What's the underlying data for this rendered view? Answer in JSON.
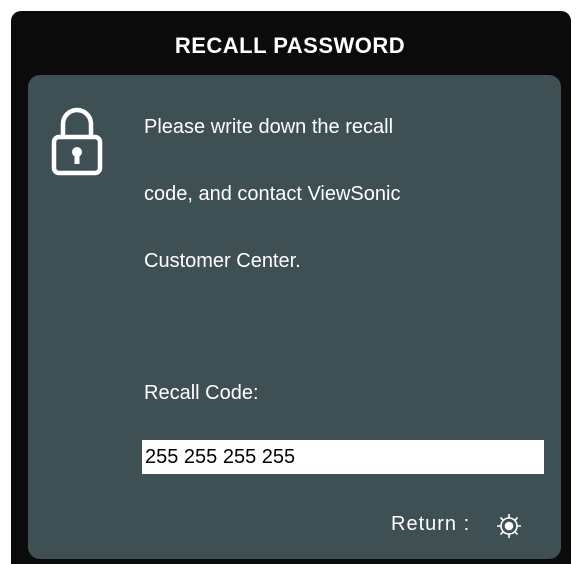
{
  "dialog": {
    "title": "RECALL PASSWORD",
    "message_lines": [
      "Please write down the recall",
      "code, and contact ViewSonic",
      "Customer Center."
    ],
    "recall_code_label": "Recall Code:",
    "recall_code_value": "255  255  255  255",
    "return_label": "Return :"
  },
  "icons": {
    "lock": "lock-icon",
    "return": "gear-icon"
  },
  "colors": {
    "frame": "#0b0b0b",
    "panel": "#3e5054",
    "text": "#ffffff",
    "code_box": "#ffffff"
  }
}
